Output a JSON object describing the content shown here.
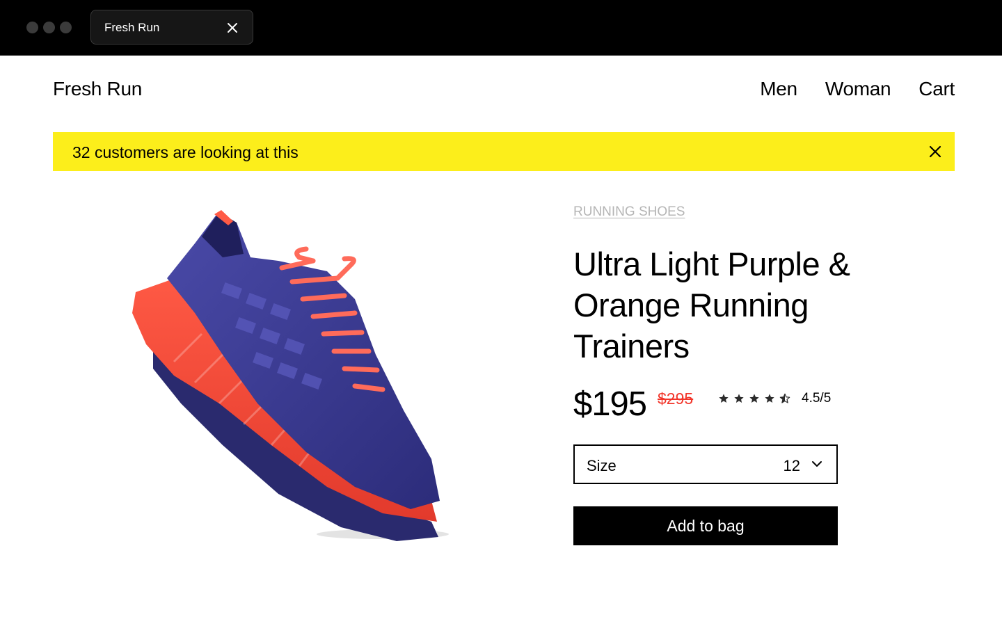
{
  "browser": {
    "tab_title": "Fresh Run"
  },
  "header": {
    "brand": "Fresh Run",
    "nav": {
      "men": "Men",
      "woman": "Woman",
      "cart": "Cart"
    }
  },
  "banner": {
    "text": "32 customers are looking at this",
    "background_color": "#fcee1b"
  },
  "product": {
    "category": "RUNNING SHOES",
    "title": "Ultra Light Purple & Orange Running Trainers",
    "price": "$195",
    "old_price": "$295",
    "rating_value": 4.5,
    "rating_max": 5,
    "rating_text": "4.5/5",
    "image_icon": "running-shoe-image",
    "size": {
      "label": "Size",
      "selected": "12"
    },
    "add_to_bag_label": "Add to bag"
  },
  "colors": {
    "accent_sale": "#f2352a",
    "shoe_primary": "#3f3f9e",
    "shoe_accent": "#ff4b3a"
  }
}
